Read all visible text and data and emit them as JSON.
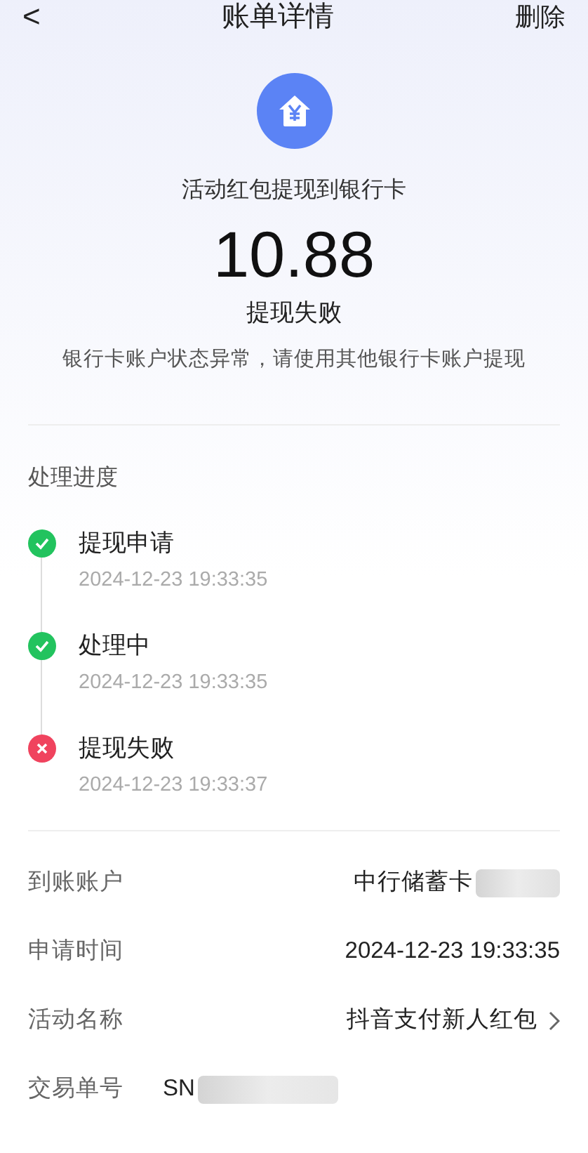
{
  "header": {
    "back": "<",
    "title": "账单详情",
    "action": "删除"
  },
  "summary": {
    "subtitle": "活动红包提现到银行卡",
    "amount": "10.88",
    "status": "提现失败",
    "message": "银行卡账户状态异常，请使用其他银行卡账户提现"
  },
  "progress": {
    "title": "处理进度",
    "steps": [
      {
        "label": "提现申请",
        "time": "2024-12-23 19:33:35",
        "kind": "done"
      },
      {
        "label": "处理中",
        "time": "2024-12-23 19:33:35",
        "kind": "done"
      },
      {
        "label": "提现失败",
        "time": "2024-12-23 19:33:37",
        "kind": "failed"
      }
    ]
  },
  "details": [
    {
      "label": "到账账户",
      "value": "中行储蓄卡",
      "redacted": true,
      "link": false,
      "kind": "right"
    },
    {
      "label": "申请时间",
      "value": "2024-12-23 19:33:35",
      "redacted": false,
      "link": false,
      "kind": "right"
    },
    {
      "label": "活动名称",
      "value": "抖音支付新人红包",
      "redacted": false,
      "link": true,
      "kind": "right"
    },
    {
      "label": "交易单号",
      "value": "SN",
      "redacted": true,
      "link": false,
      "kind": "left"
    }
  ]
}
